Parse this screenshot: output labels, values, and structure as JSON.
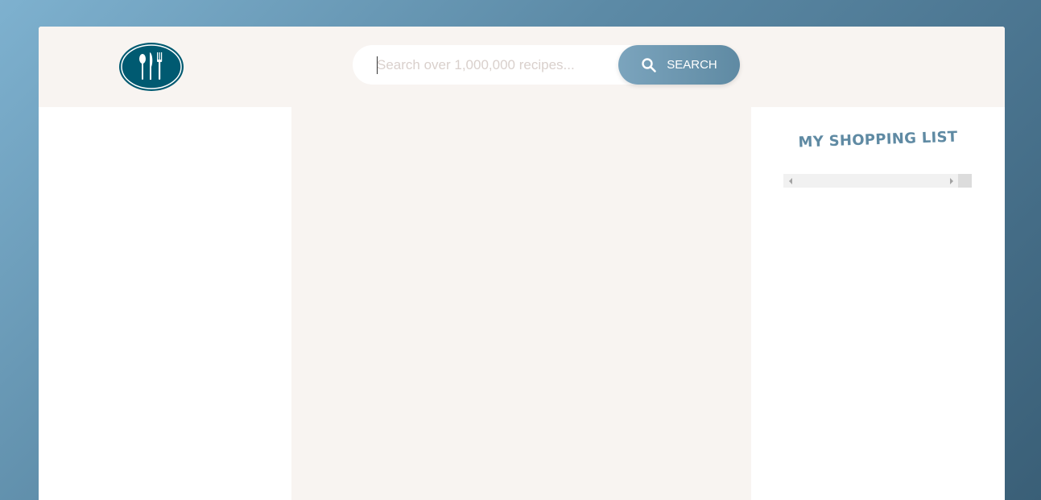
{
  "header": {
    "logo_icon": "cutlery-plate-icon",
    "search": {
      "placeholder": "Search over 1,000,000 recipes...",
      "value": "",
      "button_label": "SEARCH",
      "button_icon": "search-icon"
    }
  },
  "shopping_list": {
    "title": "MY SHOPPING LIST"
  },
  "colors": {
    "brand": "#005a71",
    "accent": "#5f8aa3",
    "panel_bg": "#f8f4f1"
  }
}
